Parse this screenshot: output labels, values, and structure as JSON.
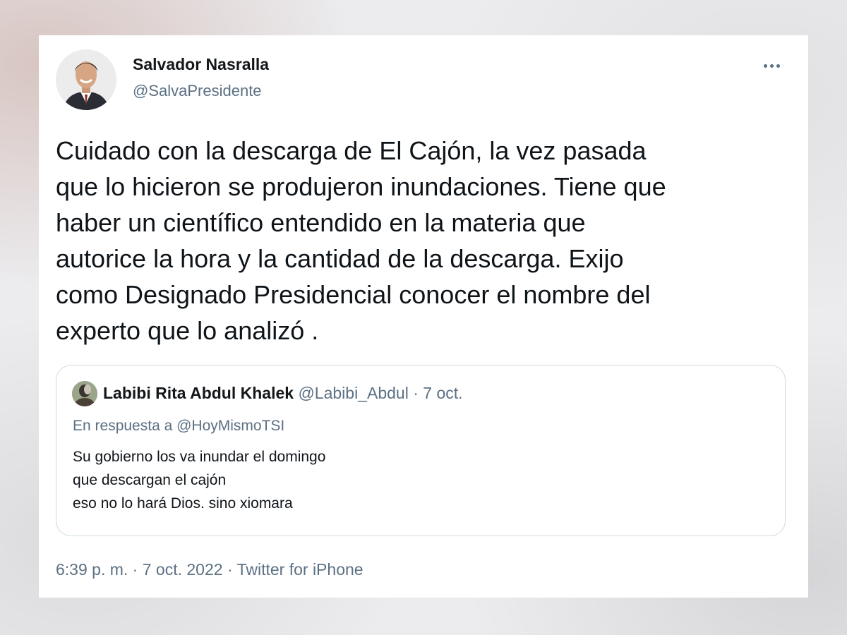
{
  "author": {
    "name": "Salvador Nasralla",
    "handle": "@SalvaPresidente",
    "more_icon": "more-horizontal-icon"
  },
  "tweet": {
    "lines": [
      "Cuidado con la descarga de El Cajón, la vez pasada",
      "que lo hicieron se produjeron inundaciones. Tiene que",
      "haber un científico entendido en la materia que",
      "autorice la hora y la cantidad de la descarga. Exijo",
      "como Designado Presidencial conocer el nombre del",
      "experto que lo analizó ."
    ]
  },
  "quoted_tweet": {
    "name": "Labibi Rita Abdul Khalek",
    "handle": "@Labibi_Abdul",
    "separator": "·",
    "date": "7 oct.",
    "reply_to": "En respuesta a @HoyMismoTSI",
    "lines": [
      "Su gobierno los va inundar el domingo",
      "que descargan el cajón",
      "eso no lo hará Dios. sino xiomara"
    ]
  },
  "meta": {
    "time": "6:39 p. m.",
    "sep1": "·",
    "date": "7 oct. 2022",
    "sep2": "·",
    "source": "Twitter for iPhone"
  },
  "colors": {
    "text_primary": "#0f1419",
    "text_secondary": "#5b7083",
    "border": "#cfd9de",
    "card_background": "#ffffff"
  }
}
